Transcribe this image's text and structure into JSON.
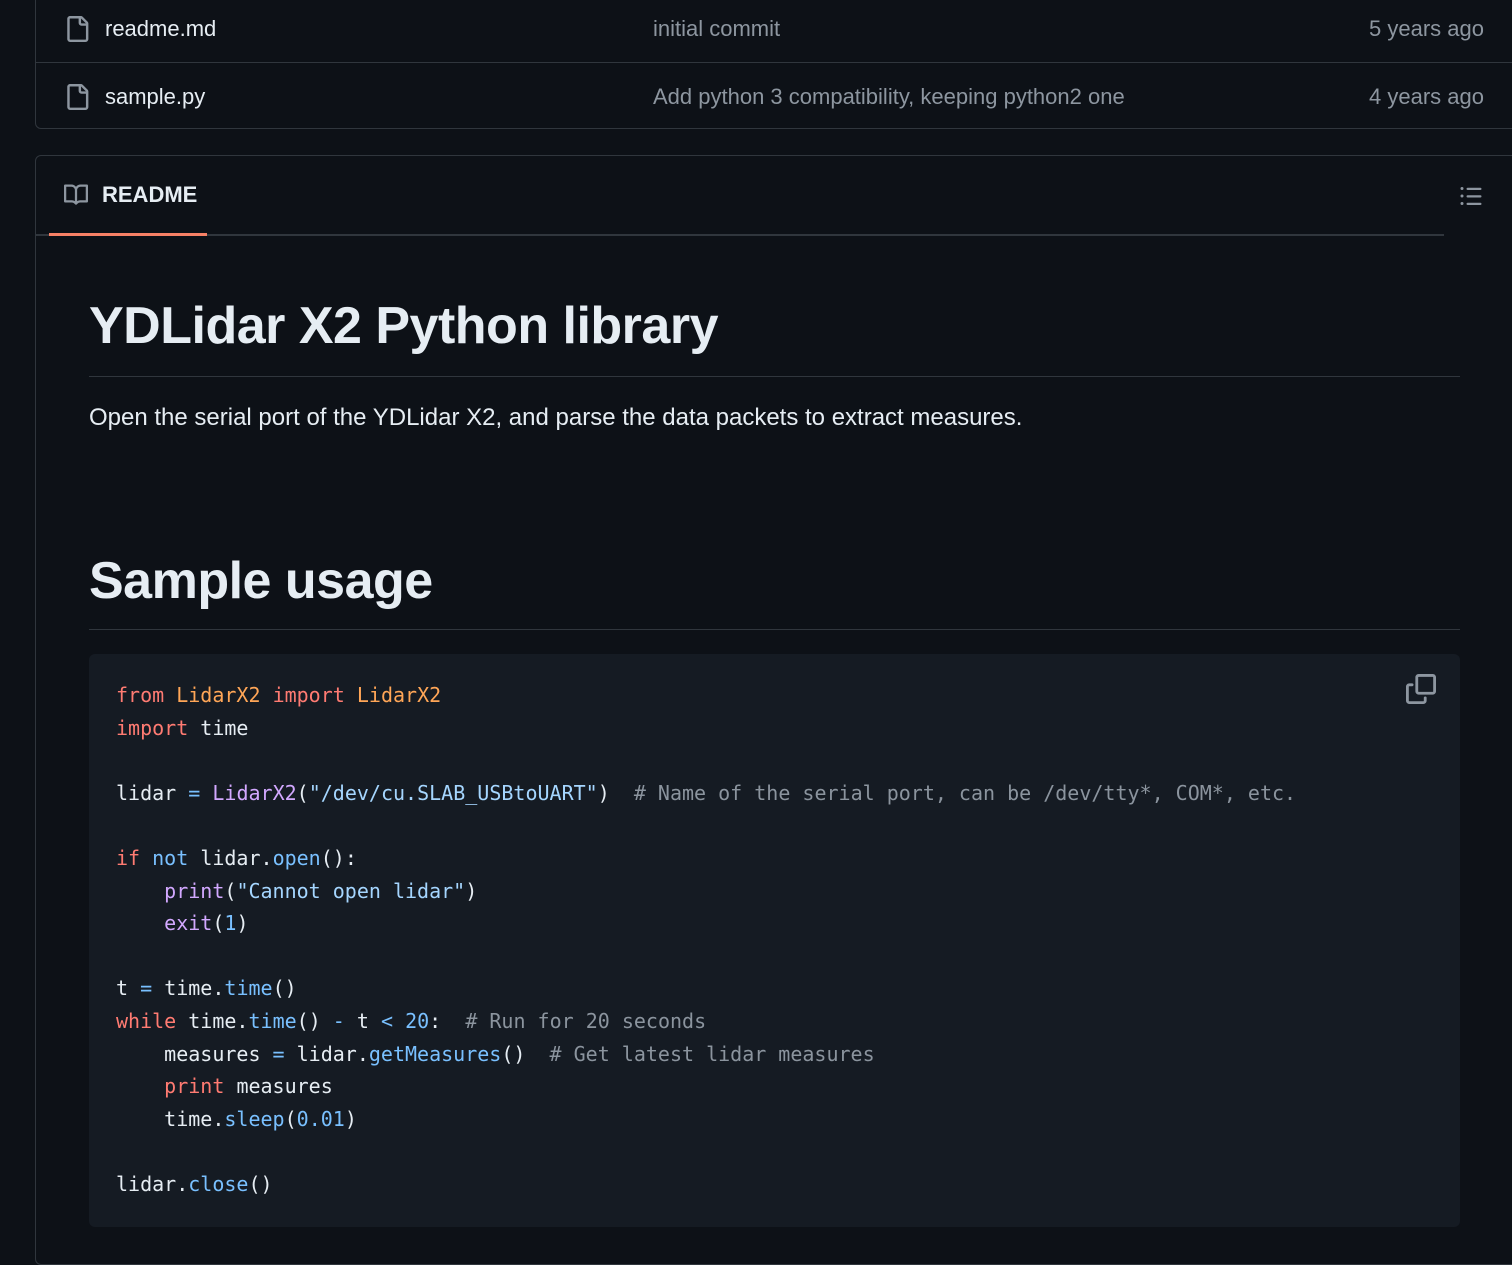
{
  "files": [
    {
      "icon": "file-icon",
      "name": "readme.md",
      "commit": "initial commit",
      "age": "5 years ago"
    },
    {
      "icon": "file-icon",
      "name": "sample.py",
      "commit": "Add python 3 compatibility, keeping python2 one",
      "age": "4 years ago"
    }
  ],
  "readme": {
    "tab_label": "README",
    "title": "YDLidar X2 Python library",
    "description": "Open the serial port of the YDLidar X2, and parse the data packets to extract measures.",
    "section_heading": "Sample usage",
    "code": {
      "line1": {
        "from": "from",
        "module": "LidarX2",
        "import": "import",
        "cls": "LidarX2"
      },
      "line2": {
        "import": "import",
        "name": "time"
      },
      "line3": {
        "var": "lidar",
        "eq": "=",
        "cls": "LidarX2",
        "open_paren": "(",
        "arg": "\"/dev/cu.SLAB_USBtoUART\"",
        "close_paren": ")",
        "comment": "# Name of the serial port, can be /dev/tty*, COM*, etc."
      },
      "line4": {
        "kw_if": "if",
        "kw_not": "not",
        "obj": "lidar.",
        "method": "open",
        "rest": "():"
      },
      "line5": {
        "fn": "print",
        "open_paren": "(",
        "arg": "\"Cannot open lidar\"",
        "close_paren": ")"
      },
      "line6": {
        "fn": "exit",
        "open_paren": "(",
        "arg": "1",
        "close_paren": ")"
      },
      "line7": {
        "var": "t",
        "eq": "=",
        "obj": "time.",
        "method": "time",
        "rest": "()"
      },
      "line8": {
        "kw": "while",
        "obj": "time.",
        "method": "time",
        "rest": "()",
        "minus": "-",
        "var": "t",
        "lt": "<",
        "num": "20",
        "colon": ":",
        "comment": "# Run for 20 seconds"
      },
      "line9": {
        "var": "measures",
        "eq": "=",
        "obj": "lidar.",
        "method": "getMeasures",
        "rest": "()",
        "comment": "# Get latest lidar measures"
      },
      "line10": {
        "kw": "print",
        "name": "measures"
      },
      "line11": {
        "obj": "time.",
        "method": "sleep",
        "open_paren": "(",
        "num": "0.01",
        "close_paren": ")"
      },
      "line12": {
        "obj": "lidar.",
        "method": "close",
        "rest": "()"
      }
    }
  },
  "icons": {
    "file": "file-icon",
    "book": "book-icon",
    "outline": "list-unordered-icon",
    "copy": "copy-icon"
  },
  "colors": {
    "background": "#0d1117",
    "border": "#30363d",
    "tab_underline": "#f78166",
    "code_background": "#151b23"
  }
}
